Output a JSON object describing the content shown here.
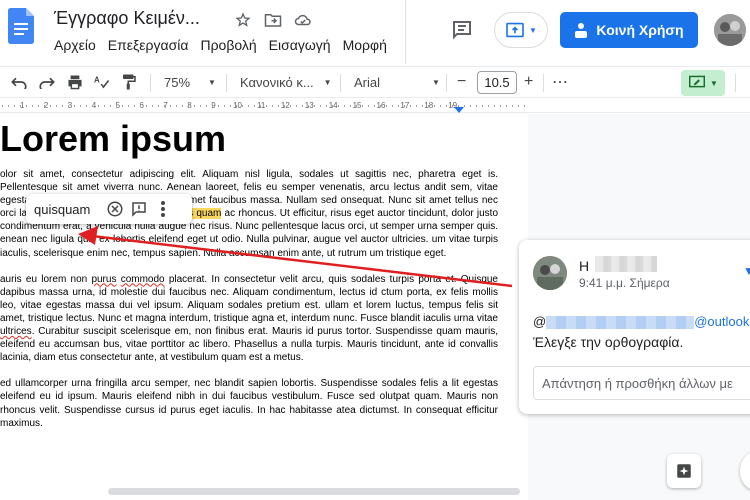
{
  "app": {
    "doc_title": "Έγγραφο Κειμέν...",
    "menu": [
      "Αρχείο",
      "Επεξεργασία",
      "Προβολή",
      "Εισαγωγή",
      "Μορφή"
    ],
    "share_label": "Κοινή Χρήση"
  },
  "toolbar": {
    "zoom": "75%",
    "style": "Κανονικό κ...",
    "font": "Arial",
    "font_size": "10.5",
    "minus": "−",
    "plus": "+",
    "more": "⋯"
  },
  "ruler": {
    "numbers": [
      "1",
      "2",
      "3",
      "4",
      "5",
      "6",
      "7",
      "8",
      "9",
      "10",
      "11",
      "12",
      "13",
      "14",
      "15",
      "16",
      "17",
      "18",
      "19"
    ]
  },
  "document": {
    "heading": "Lorem ipsum",
    "p1_pre": "olor sit amet, consectetur adipiscing elit. Aliquam nisl ligula, sodales ut sagittis nec, pharetra eget is. Pellentesque sit amet viverra nunc. Aenean laoreet, felis eu semper venenatis, arcu lectus andit sem, vitae egestas massa dui vel amet ex. Sed sit amet faucibus massa. Nullam sed onsequat. Nunc sit amet tellus nec orci lacinia ullamcorper. Mauris empus ",
    "p1_hl": "quis quam",
    "p1_post": " ac rhoncus. Ut efficitur, risus eget auctor tincidunt, dolor justo condimentum erat, a vehicula nulla augue nec risus. Nunc pellentesque lacus orci, ut semper urna semper quis. enean nec ligula quis ex lobortis eleifend eget ut odio. Nulla pulvinar, augue vel auctor ultricies. um vitae turpis iaculis, scelerisque enim nec, tempus sapien. Nulla accumsan enim ante, ut rutrum um tristique eget.",
    "p2_a": "auris eu lorem non ",
    "p2_sq1": "purus",
    "p2_b": " ",
    "p2_sq2": "commodo",
    "p2_c": " placerat. In consectetur velit arcu, quis sodales turpis porta et. Quisque dapibus massa urna, id molestie dui faucibus nec. Aliquam condimentum, lectus id ctum porta, ex felis mollis leo, vitae egestas massa dui vel ipsum. Aliquam sodales pretium est. ullam et lorem luctus, tempus felis sit amet, tristique lectus. Nunc et magna interdum, tristique agna et, interdum nunc. Fusce blandit iaculis urna vitae ",
    "p2_sq3": "ultrices",
    "p2_d": ". Curabitur suscipit scelerisque em, non finibus erat. Mauris id purus tortor. Suspendisse quam mauris, eleifend eu accumsan bus, vitae porttitor ac libero. Phasellus a nulla turpis. Mauris tincidunt, ante id convallis lacinia, diam etus consectetur ante, at vestibulum quam est a metus.",
    "p3": "ed ullamcorper urna fringilla arcu semper, nec blandit sapien lobortis. Suspendisse sodales felis a lit egestas eleifend eu id ipsum. Mauris eleifend nibh in dui faucibus vestibulum. Fusce sed olutpat quam. Mauris non rhoncus velit. Suspendisse cursus id purus eget iaculis. In hac habitasse atea dictumst. In consequat efficitur maximus."
  },
  "spell_popup": {
    "suggestion": "quisquam"
  },
  "comment": {
    "name_prefix": "Η",
    "time": "9:41 μ.μ. Σήμερα",
    "at": "@",
    "mail_domain": "@outlook.c",
    "body": "Έλεγξε την ορθογραφία.",
    "reply_placeholder": "Απάντηση ή προσθήκη άλλων με"
  },
  "colors": {
    "accent": "#1a73e8",
    "highlight": "#fbd85d",
    "arrow": "#e02020",
    "edit_mode_bg": "#c4eed0"
  }
}
